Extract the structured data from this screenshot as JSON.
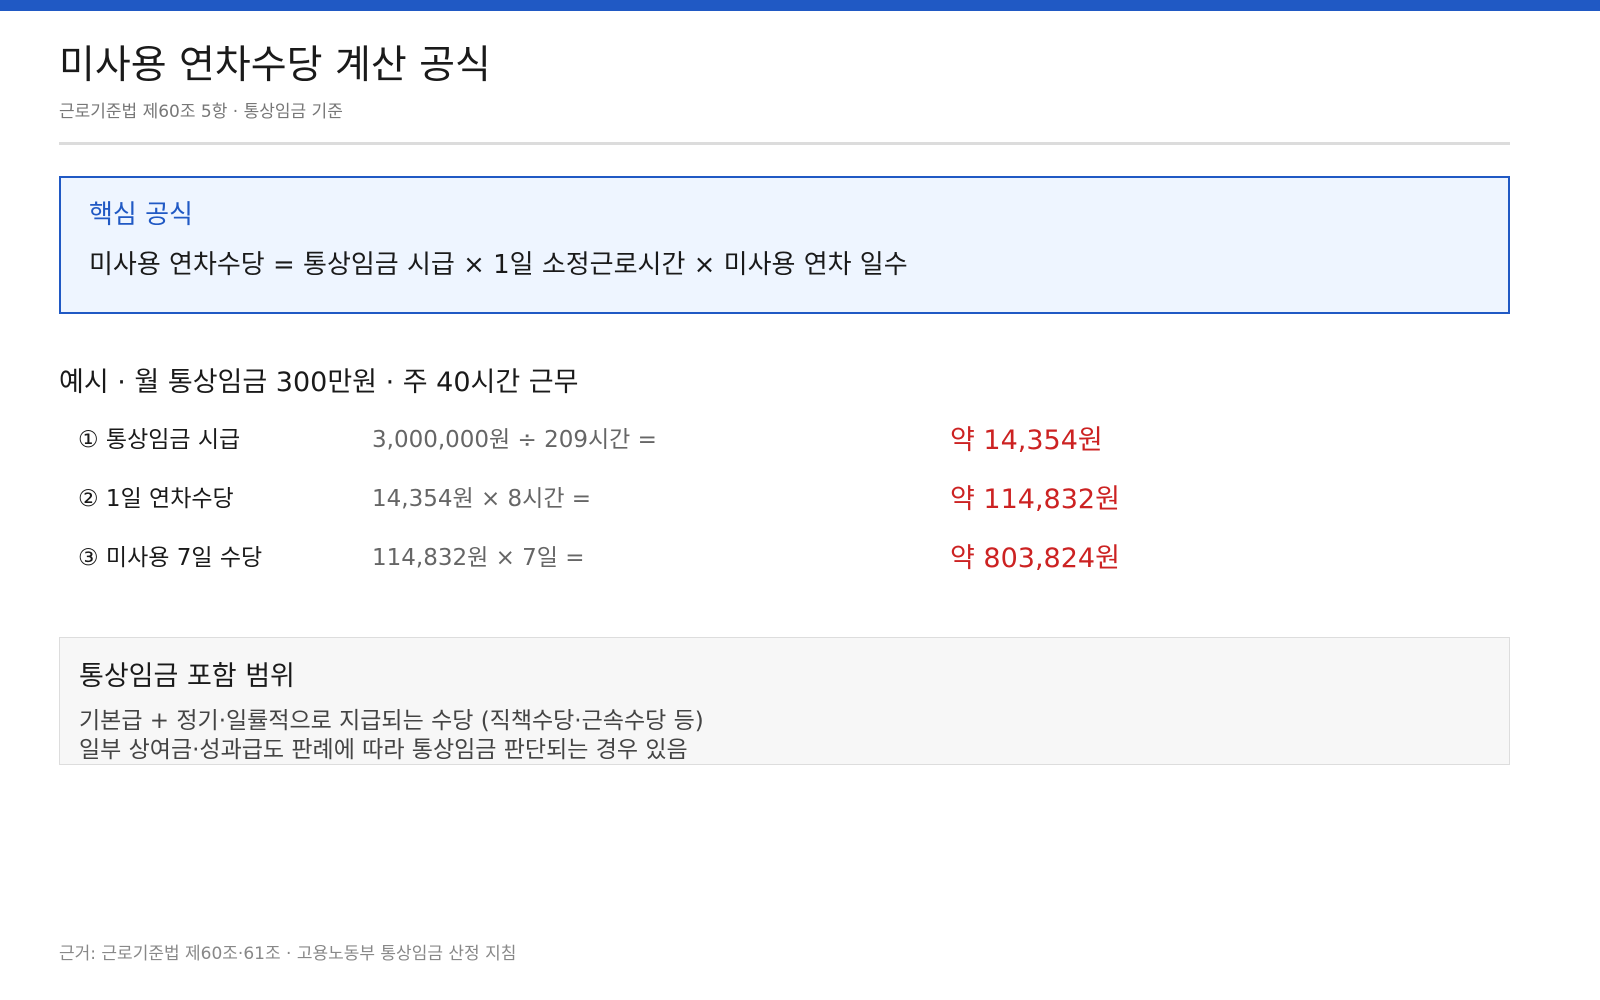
{
  "colors": {
    "accent": "#2059c4",
    "result": "#cc2222",
    "formula_bg": "#eef5ff",
    "scope_bg": "#f7f7f7"
  },
  "header": {
    "title": "미사용 연차수당 계산 공식",
    "subtitle": "근로기준법 제60조 5항 · 통상임금 기준"
  },
  "formula": {
    "label": "핵심 공식",
    "text": "미사용 연차수당 = 통상임금 시급 × 1일 소정근로시간 × 미사용 연차 일수"
  },
  "example": {
    "title": "예시 · 월 통상임금 300만원 · 주 40시간 근무",
    "rows": [
      {
        "label": "① 통상임금 시급",
        "expr": "3,000,000원 ÷ 209시간 =",
        "result": "약 14,354원"
      },
      {
        "label": "② 1일 연차수당",
        "expr": "14,354원 × 8시간 =",
        "result": "약 114,832원"
      },
      {
        "label": "③ 미사용 7일 수당",
        "expr": "114,832원 × 7일 =",
        "result": "약 803,824원"
      }
    ]
  },
  "scope": {
    "title": "통상임금 포함 범위",
    "lines": [
      "기본급 + 정기·일률적으로 지급되는 수당 (직책수당·근속수당 등)",
      "일부 상여금·성과급도 판례에 따라 통상임금 판단되는 경우 있음"
    ]
  },
  "footer": {
    "note": "근거: 근로기준법 제60조·61조 · 고용노동부 통상임금 산정 지침"
  }
}
